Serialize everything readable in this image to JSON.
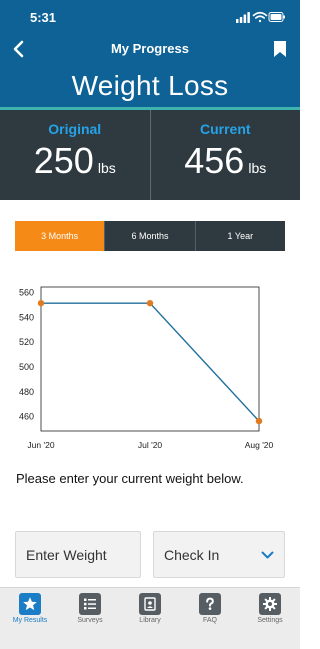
{
  "status": {
    "time": "5:31"
  },
  "nav": {
    "title": "My Progress"
  },
  "hero": {
    "title": "Weight Loss"
  },
  "stats": {
    "original": {
      "label": "Original",
      "value": "250",
      "unit": "lbs"
    },
    "current": {
      "label": "Current",
      "value": "456",
      "unit": "lbs"
    }
  },
  "range_tabs": [
    {
      "label": "3 Months",
      "active": true
    },
    {
      "label": "6 Months",
      "active": false
    },
    {
      "label": "1 Year",
      "active": false
    }
  ],
  "chart_data": {
    "type": "line",
    "x": [
      "Jun '20",
      "Jul '20",
      "Aug '20"
    ],
    "series": [
      {
        "values": [
          551,
          551,
          456
        ]
      }
    ],
    "yticks": [
      460,
      480,
      500,
      520,
      540,
      560
    ],
    "ylim": [
      448,
      564
    ],
    "grid": false,
    "line_color": "#1f6f9c",
    "marker_color": "#e07b22"
  },
  "prompt": "Please enter your current weight below.",
  "weight_input": {
    "placeholder": "Enter Weight"
  },
  "checkin": {
    "label": "Check In"
  },
  "tabbar": [
    {
      "label": "My Results",
      "icon": "star-icon",
      "active": true
    },
    {
      "label": "Surveys",
      "icon": "list-icon",
      "active": false
    },
    {
      "label": "Library",
      "icon": "library-icon",
      "active": false
    },
    {
      "label": "FAQ",
      "icon": "question-icon",
      "active": false
    },
    {
      "label": "Settings",
      "icon": "gear-icon",
      "active": false
    }
  ],
  "colors": {
    "brand_blue": "#0e6296",
    "accent_teal": "#3fb3ad",
    "dark_panel": "#2f3a40",
    "stat_label_blue": "#24a3e8",
    "active_tab_orange": "#f58a17",
    "tabbar_active": "#1b7dc5"
  }
}
